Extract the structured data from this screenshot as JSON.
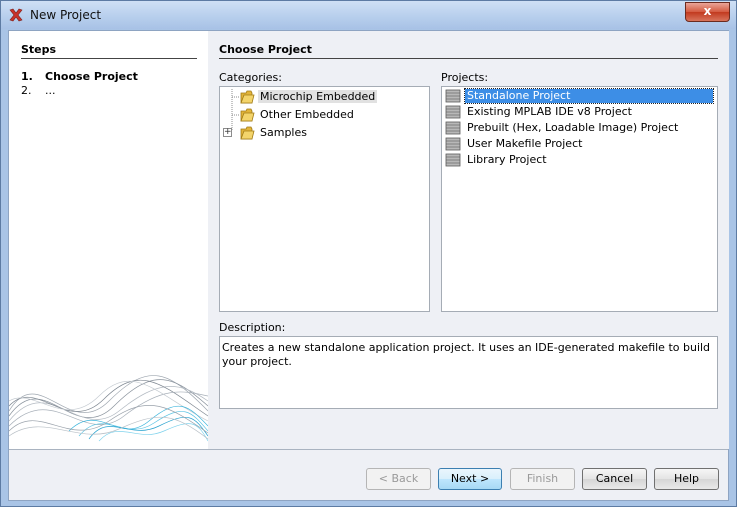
{
  "window": {
    "title": "New Project",
    "close_label": "x"
  },
  "steps": {
    "heading": "Steps",
    "items": [
      {
        "num": "1.",
        "label": "Choose Project"
      },
      {
        "num": "2.",
        "label": "..."
      }
    ]
  },
  "main": {
    "heading": "Choose Project",
    "categories_label": "Categories:",
    "categories": [
      {
        "label": "Microchip Embedded",
        "selected": true,
        "icon": "folder-icon"
      },
      {
        "label": "Other Embedded",
        "selected": false,
        "icon": "folder-icon"
      },
      {
        "label": "Samples",
        "selected": false,
        "icon": "folder-icon",
        "expander": "+"
      }
    ],
    "projects_label": "Projects:",
    "projects": [
      {
        "label": "Standalone Project",
        "selected": true,
        "icon": "chip-icon"
      },
      {
        "label": "Existing MPLAB IDE v8 Project",
        "selected": false,
        "icon": "chip-icon"
      },
      {
        "label": "Prebuilt (Hex, Loadable Image) Project",
        "selected": false,
        "icon": "chip-icon"
      },
      {
        "label": "User Makefile Project",
        "selected": false,
        "icon": "chip-icon"
      },
      {
        "label": "Library Project",
        "selected": false,
        "icon": "chip-icon"
      }
    ],
    "description_label": "Description:",
    "description": "Creates a new standalone application project. It uses an IDE-generated makefile to build your project."
  },
  "buttons": {
    "back": "< Back",
    "next": "Next >",
    "finish": "Finish",
    "cancel": "Cancel",
    "help": "Help"
  },
  "colors": {
    "selection": "#3d8ee6",
    "titlebar": "#b8cfed",
    "close": "#c23a1f",
    "wave_accent": "#3db5dc"
  }
}
